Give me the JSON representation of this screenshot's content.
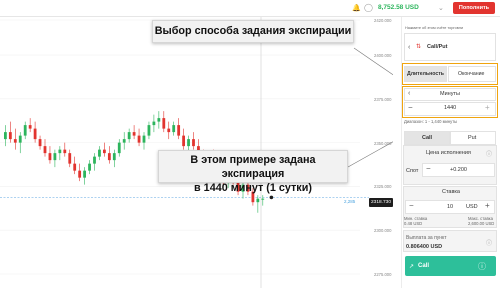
{
  "header": {
    "balance": "8,752.58 USD",
    "deposit_label": "Пополнить",
    "bell_icon": "bell-icon",
    "avatar_icon": "avatar-icon",
    "chevron_icon": "chevron-down-icon"
  },
  "callouts": {
    "expiry_method": "Выбор способа задания экспирации",
    "example_line1": "В этом примере задана экспирация",
    "example_line2": "в 1440 минут (1 сутки)"
  },
  "chart": {
    "price_ticks": [
      "2420.000",
      "2400.000",
      "2375.000",
      "2350.000",
      "2325.000",
      "2300.000",
      "2275.000"
    ],
    "current_price": "2318.730",
    "dashed_price_label": "2,285",
    "candles": [
      [
        2352,
        2360,
        2348,
        2356
      ],
      [
        2356,
        2362,
        2350,
        2352
      ],
      [
        2352,
        2358,
        2346,
        2350
      ],
      [
        2350,
        2356,
        2344,
        2354
      ],
      [
        2354,
        2362,
        2352,
        2360
      ],
      [
        2360,
        2364,
        2356,
        2358
      ],
      [
        2358,
        2362,
        2350,
        2352
      ],
      [
        2352,
        2354,
        2346,
        2348
      ],
      [
        2348,
        2352,
        2342,
        2344
      ],
      [
        2344,
        2348,
        2338,
        2340
      ],
      [
        2340,
        2346,
        2336,
        2344
      ],
      [
        2344,
        2348,
        2340,
        2346
      ],
      [
        2346,
        2350,
        2342,
        2344
      ],
      [
        2344,
        2346,
        2336,
        2338
      ],
      [
        2338,
        2342,
        2332,
        2334
      ],
      [
        2334,
        2338,
        2328,
        2330
      ],
      [
        2330,
        2336,
        2326,
        2334
      ],
      [
        2334,
        2340,
        2332,
        2338
      ],
      [
        2338,
        2344,
        2334,
        2342
      ],
      [
        2342,
        2348,
        2340,
        2346
      ],
      [
        2346,
        2350,
        2342,
        2344
      ],
      [
        2344,
        2348,
        2338,
        2340
      ],
      [
        2340,
        2346,
        2336,
        2344
      ],
      [
        2344,
        2352,
        2342,
        2350
      ],
      [
        2350,
        2356,
        2346,
        2352
      ],
      [
        2352,
        2358,
        2350,
        2356
      ],
      [
        2356,
        2360,
        2352,
        2354
      ],
      [
        2354,
        2358,
        2348,
        2350
      ],
      [
        2350,
        2356,
        2346,
        2354
      ],
      [
        2354,
        2362,
        2352,
        2360
      ],
      [
        2360,
        2366,
        2356,
        2362
      ],
      [
        2362,
        2368,
        2358,
        2364
      ],
      [
        2364,
        2368,
        2356,
        2358
      ],
      [
        2358,
        2362,
        2352,
        2356
      ],
      [
        2356,
        2362,
        2354,
        2360
      ],
      [
        2360,
        2364,
        2352,
        2354
      ],
      [
        2354,
        2358,
        2346,
        2348
      ],
      [
        2348,
        2354,
        2344,
        2352
      ],
      [
        2352,
        2356,
        2346,
        2348
      ],
      [
        2348,
        2352,
        2340,
        2342
      ],
      [
        2342,
        2346,
        2336,
        2338
      ],
      [
        2338,
        2344,
        2334,
        2342
      ],
      [
        2342,
        2346,
        2336,
        2338
      ],
      [
        2338,
        2340,
        2330,
        2332
      ],
      [
        2332,
        2336,
        2326,
        2328
      ],
      [
        2328,
        2334,
        2324,
        2332
      ],
      [
        2332,
        2336,
        2326,
        2328
      ],
      [
        2328,
        2330,
        2320,
        2322
      ],
      [
        2322,
        2328,
        2318,
        2326
      ],
      [
        2326,
        2330,
        2320,
        2322
      ],
      [
        2322,
        2324,
        2314,
        2316
      ],
      [
        2316,
        2320,
        2310,
        2318
      ],
      [
        2318,
        2320,
        2314,
        2318
      ]
    ]
  },
  "panel": {
    "asset_hint": "Нажмите об этом счёте торговли",
    "asset_name": "Call/Put",
    "expiry_tabs": [
      "Длительность",
      "Окончание"
    ],
    "duration_unit": "Минуты",
    "duration_value": "1440",
    "duration_range": "Диапазон: 1 - 1,440 минуты",
    "direction_tabs": [
      "Call",
      "Put"
    ],
    "strike_label": "Цена исполнения",
    "spot_label": "Спот",
    "spot_value": "+0.200",
    "stake_label": "Ставка",
    "stake_value": "10",
    "currency": "USD",
    "min_stake_label": "Мин. ставка",
    "min_stake_value": "0.48 USD",
    "max_stake_label": "Макс. ставка",
    "max_stake_value": "2,600.00 USD",
    "payout_label": "Выплата за пункт",
    "payout_value": "0.806400 USD",
    "call_button": "Call"
  },
  "colors": {
    "accent_green": "#2db55d",
    "deposit_red": "#e2342f",
    "highlight_orange": "#f0a40e",
    "candle_up": "#2db55d",
    "candle_down": "#e2342f",
    "call_green": "#2dbf9a"
  }
}
